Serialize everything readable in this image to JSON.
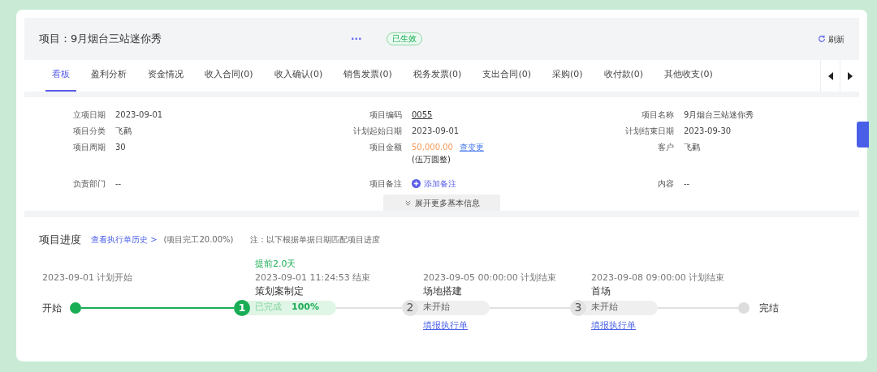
{
  "header": {
    "title_label": "项目：",
    "title": "9月烟台三站迷你秀",
    "more": "···",
    "status": "已生效",
    "refresh": "刷新"
  },
  "tabs": [
    {
      "label": "看板",
      "selected": true
    },
    {
      "label": "盈利分析",
      "selected": false
    },
    {
      "label": "资金情况",
      "selected": false
    },
    {
      "label": "收入合同(0)",
      "selected": false
    },
    {
      "label": "收入确认(0)",
      "selected": false
    },
    {
      "label": "销售发票(0)",
      "selected": false
    },
    {
      "label": "税务发票(0)",
      "selected": false
    },
    {
      "label": "支出合同(0)",
      "selected": false
    },
    {
      "label": "采购(0)",
      "selected": false
    },
    {
      "label": "收付款(0)",
      "selected": false
    },
    {
      "label": "其他收支(0)",
      "selected": false
    }
  ],
  "info": {
    "fields": [
      {
        "label": "立项日期",
        "kind": "text",
        "value": "2023-09-01"
      },
      {
        "label": "项目编码",
        "kind": "code",
        "value": "0055"
      },
      {
        "label": "项目名称",
        "kind": "text",
        "value": "9月烟台三站迷你秀"
      },
      {
        "label": "项目分类",
        "kind": "text",
        "value": "飞鹳"
      },
      {
        "label": "计划起始日期",
        "kind": "text",
        "value": "2023-09-01"
      },
      {
        "label": "计划结束日期",
        "kind": "text",
        "value": "2023-09-30"
      },
      {
        "label": "项目周期",
        "kind": "text",
        "value": "30"
      },
      {
        "label": "项目金额",
        "kind": "amount",
        "value": "50,000.00",
        "link": "查变更",
        "note": "(伍万圆整)"
      },
      {
        "label": "客户",
        "kind": "text",
        "value": "飞鹳"
      },
      {
        "label": "负责部门",
        "kind": "text",
        "value": "--"
      },
      {
        "label": "项目备注",
        "kind": "add",
        "value": "添加备注"
      },
      {
        "label": "内容",
        "kind": "text",
        "value": "--"
      }
    ],
    "expand": "展开更多基本信息"
  },
  "progress": {
    "title": "项目进度",
    "history_link": "查看执行单历史 >",
    "completion": "(项目完工20.00%)",
    "note": "注：以下根据单据日期匹配项目进度",
    "start": {
      "label": "开始",
      "date": "2023-09-01 计划开始"
    },
    "steps": [
      {
        "number": "1",
        "advance": "提前2.0天",
        "date": "2023-09-01 11:24:53 结束",
        "name": "策划案制定",
        "status": "已完成",
        "percent": "100%",
        "done": true
      },
      {
        "number": "2",
        "date": "2023-09-05 00:00:00 计划结束",
        "name": "场地搭建",
        "status": "未开始",
        "link": "填报执行单",
        "done": false
      },
      {
        "number": "3",
        "date": "2023-09-08 09:00:00 计划结束",
        "name": "首场",
        "status": "未开始",
        "link": "填报执行单",
        "done": false
      }
    ],
    "end": {
      "label": "完结",
      "done": false
    }
  }
}
